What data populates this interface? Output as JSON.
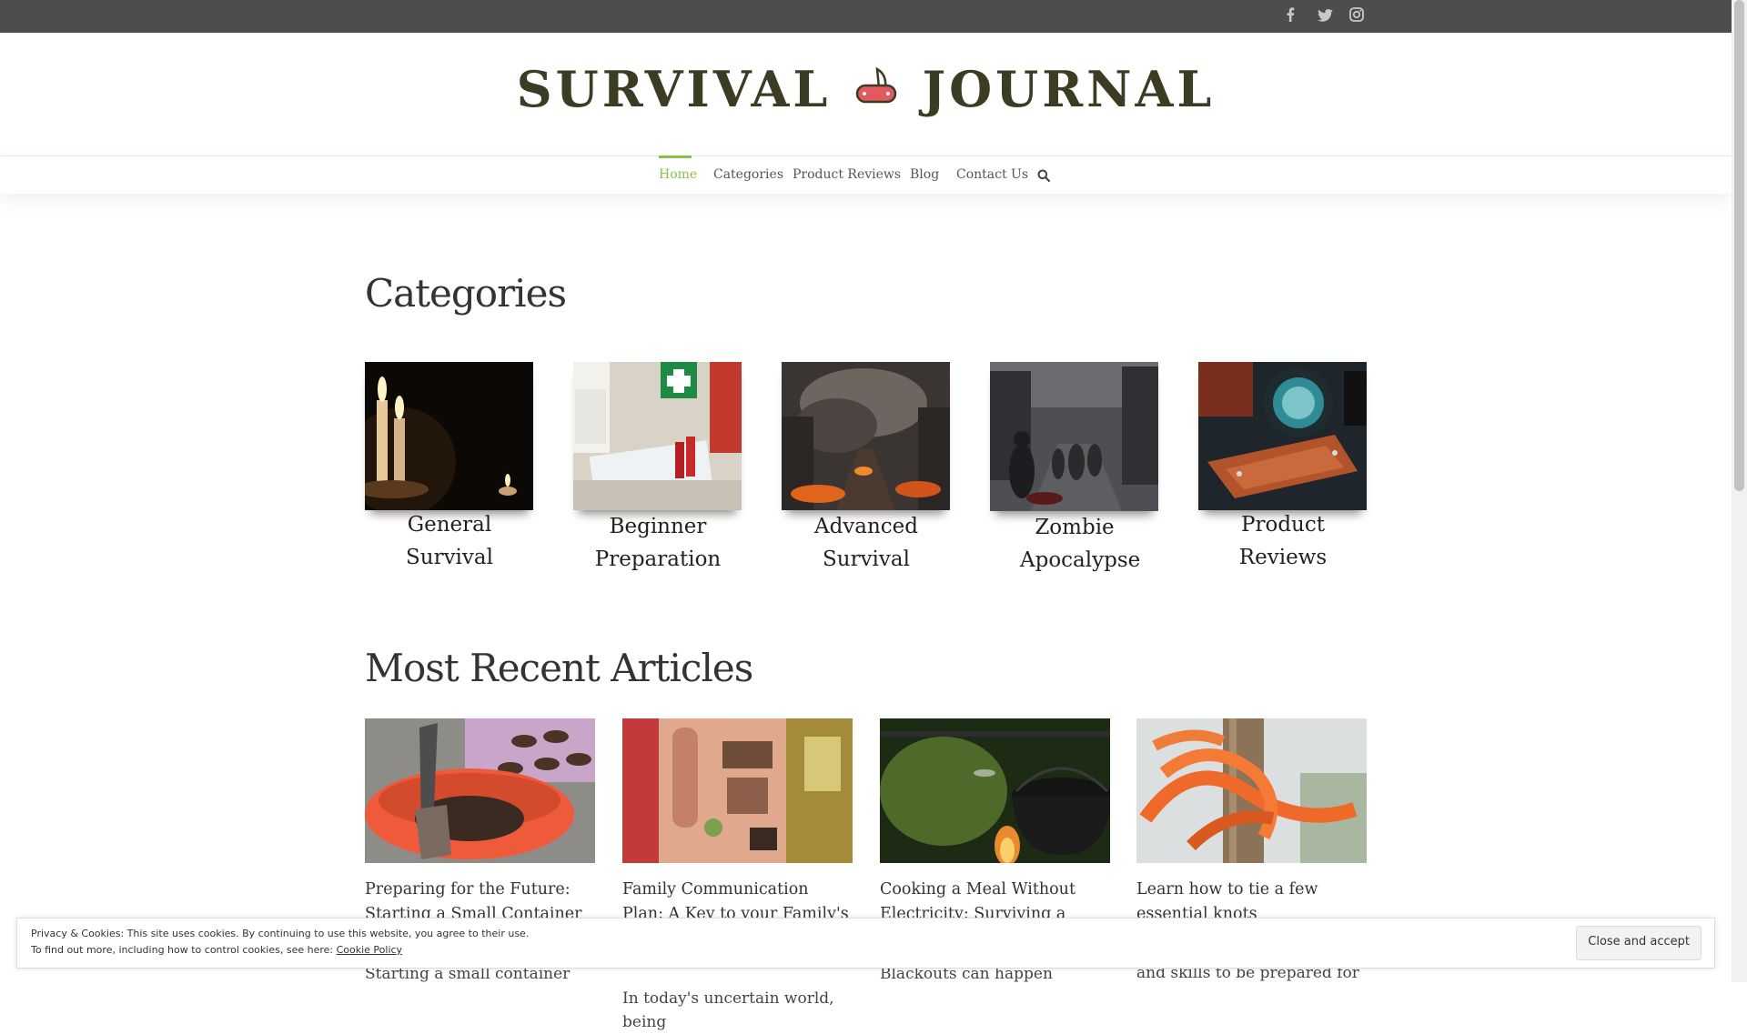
{
  "topbar": {
    "social": [
      {
        "icon": "facebook-icon",
        "glyph": "f"
      },
      {
        "icon": "twitter-icon",
        "glyph": "t"
      },
      {
        "icon": "instagram-icon",
        "glyph": "◎"
      }
    ]
  },
  "logo": {
    "word1": "SURVIVAL",
    "word2": "JOURNAL",
    "icon": "swiss-knife-icon"
  },
  "nav": {
    "items": [
      "Home",
      "Categories",
      "Product Reviews",
      "Blog",
      "Contact Us"
    ],
    "active": "Home",
    "search_icon": "search-icon"
  },
  "categories_section": {
    "title": "Categories",
    "items": [
      {
        "label": "General Survival"
      },
      {
        "label": "Beginner Preparation"
      },
      {
        "label": "Advanced Survival"
      },
      {
        "label": "Zombie Apocalypse"
      },
      {
        "label": "Product Reviews"
      }
    ]
  },
  "articles_section": {
    "title": "Most Recent Articles",
    "items": [
      {
        "title": "Preparing for the Future: Starting a Small Container Garden",
        "excerpt": "Starting a small container"
      },
      {
        "title": "Family Communication Plan: A Key to your Family's Survival in Unforeseen Events",
        "excerpt": "In today's uncertain world, being"
      },
      {
        "title": "Cooking a Meal Without Electricity: Surviving a Blackout",
        "excerpt": "Blackouts can happen"
      },
      {
        "title": "Learn how to tie a few essential knots",
        "excerpt": "When building knowledge and skills to be prepared for"
      }
    ]
  },
  "cookie": {
    "line1": "Privacy & Cookies: This site uses cookies. By continuing to use this website, you agree to their use.",
    "line2": "To find out more, including how to control cookies, see here:",
    "link": "Cookie Policy",
    "button": "Close and accept"
  },
  "colors": {
    "topbar": "#4b4d4f",
    "accent": "#8cbf4a",
    "logo": "#3c3b23"
  }
}
